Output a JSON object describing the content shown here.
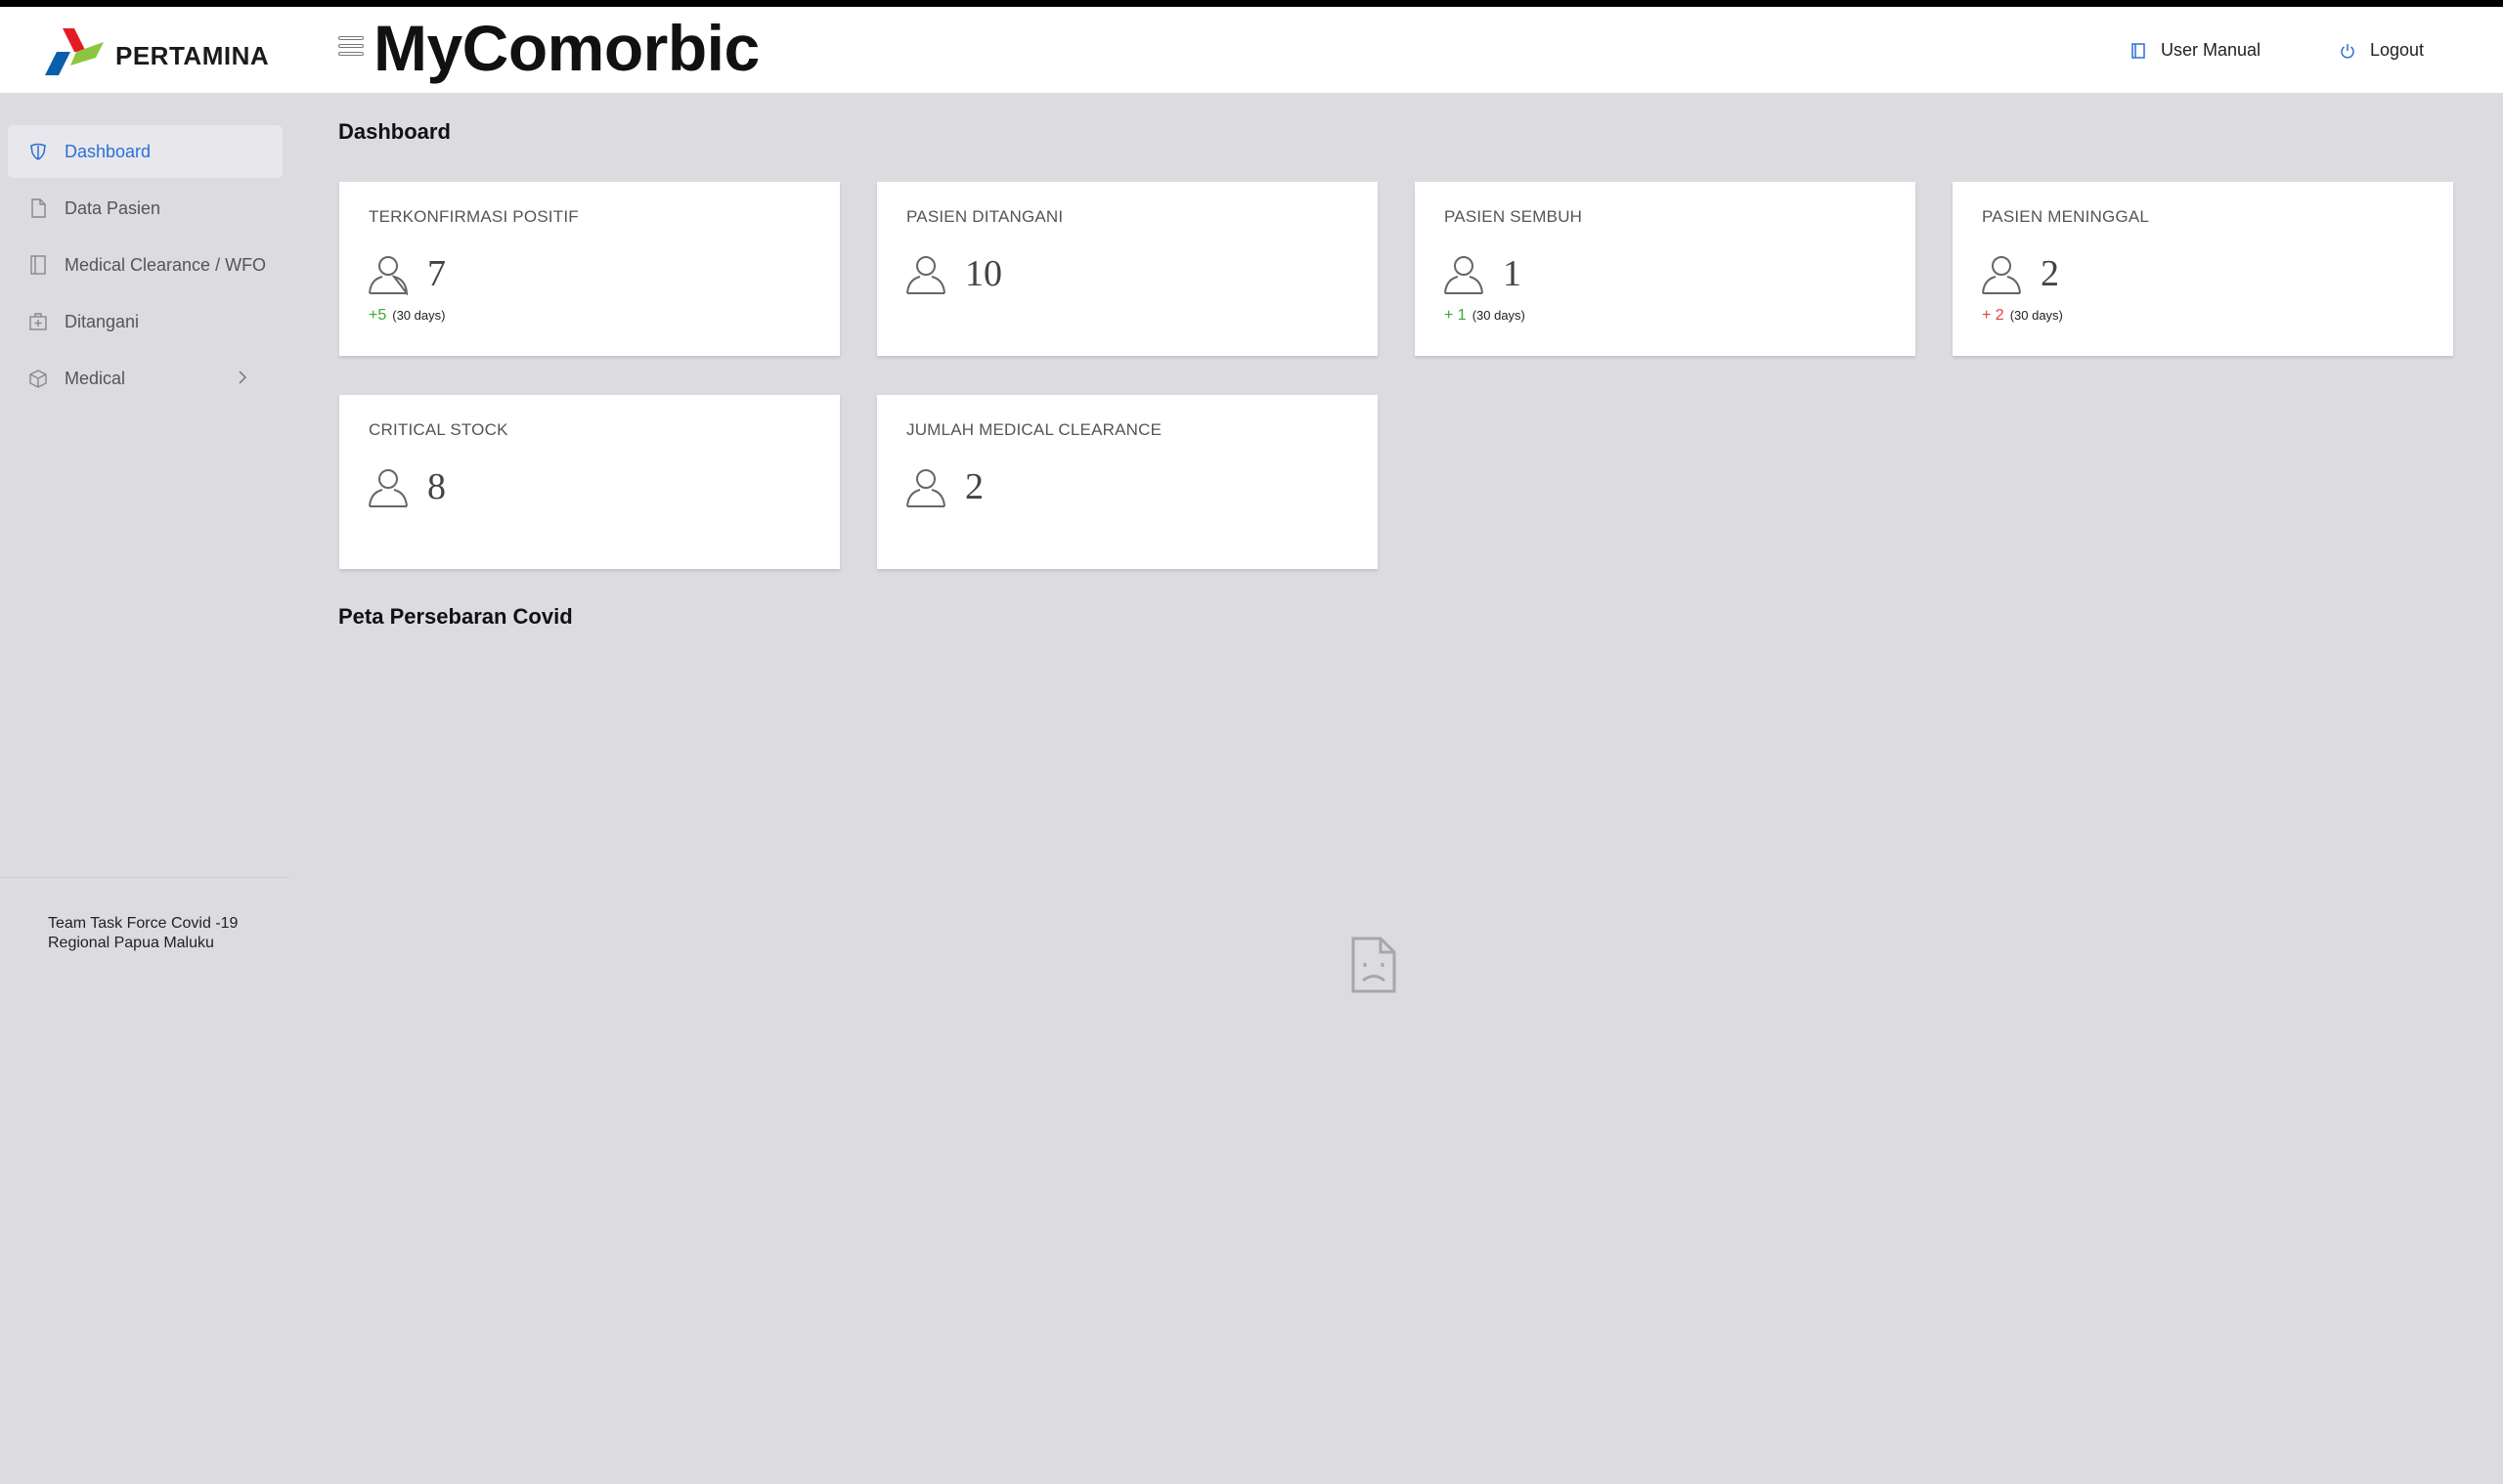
{
  "brand": {
    "logo_text": "PERTAMINA",
    "app_title": "MyComorbic"
  },
  "topnav": {
    "user_manual": "User Manual",
    "logout": "Logout"
  },
  "sidebar": {
    "items": [
      {
        "label": "Dashboard",
        "icon": "shield-icon",
        "active": true
      },
      {
        "label": "Data Pasien",
        "icon": "document-icon"
      },
      {
        "label": "Medical Clearance / WFO",
        "icon": "notebook-icon"
      },
      {
        "label": "Ditangani",
        "icon": "medkit-icon"
      },
      {
        "label": "Medical",
        "icon": "box-icon",
        "has_children": true
      }
    ],
    "footer_line1": "Team Task Force Covid -19",
    "footer_line2": "Regional Papua Maluku"
  },
  "page": {
    "title": "Dashboard",
    "map_title": "Peta Persebaran Covid"
  },
  "cards": [
    {
      "label": "TERKONFIRMASI POSITIF",
      "value": "7",
      "delta": "+5",
      "period": "(30 days)",
      "delta_color": "#3aa832"
    },
    {
      "label": "PASIEN DITANGANI",
      "value": "10"
    },
    {
      "label": "PASIEN SEMBUH",
      "value": "1",
      "delta": "+ 1",
      "period": "(30 days)",
      "delta_color": "#3aa832"
    },
    {
      "label": "PASIEN MENINGGAL",
      "value": "2",
      "delta": "+ 2",
      "period": "(30 days)",
      "delta_color": "#e04040"
    },
    {
      "label": "CRITICAL STOCK",
      "value": "8"
    },
    {
      "label": "JUMLAH MEDICAL CLEARANCE",
      "value": "2"
    }
  ],
  "colors": {
    "accent": "#2b6fd6",
    "background": "#dcdce0",
    "positive": "#3aa832",
    "negative": "#e04040"
  }
}
